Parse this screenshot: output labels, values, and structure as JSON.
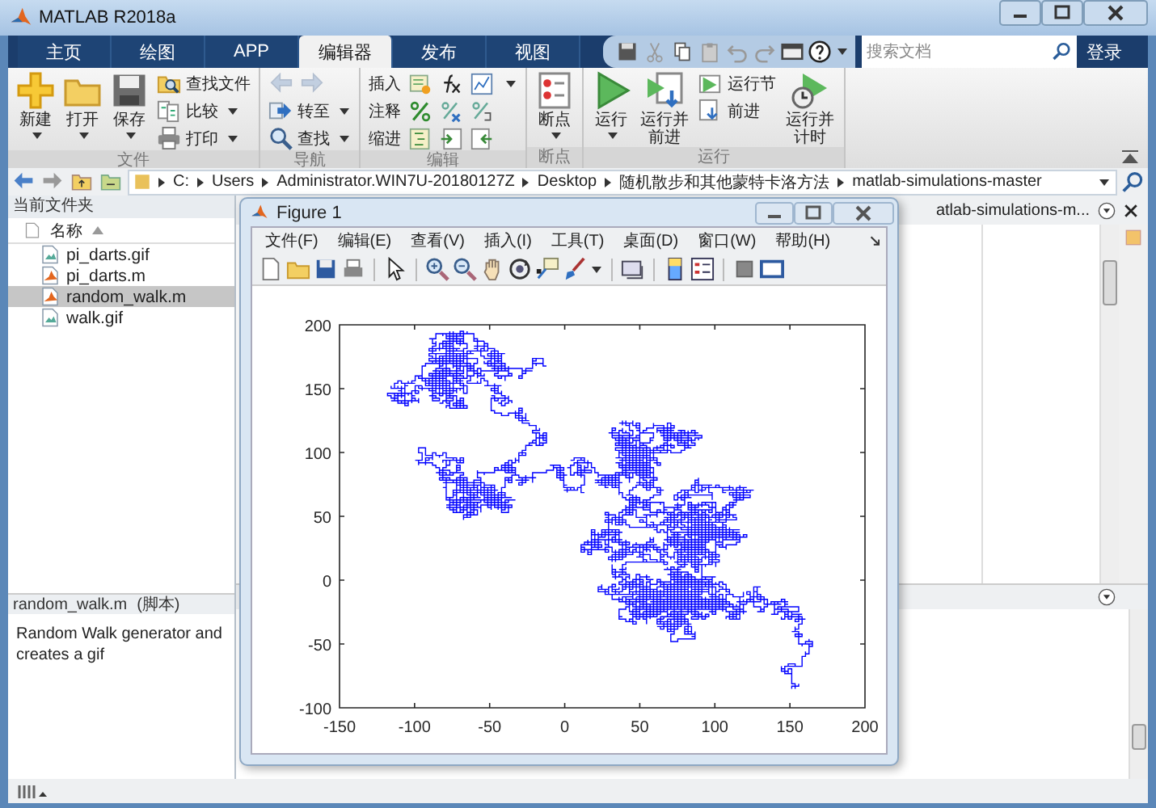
{
  "window": {
    "title": "MATLAB R2018a"
  },
  "tabs": [
    {
      "label": "主页",
      "selected": false
    },
    {
      "label": "绘图",
      "selected": false
    },
    {
      "label": "APP",
      "selected": false
    },
    {
      "label": "编辑器",
      "selected": true
    },
    {
      "label": "发布",
      "selected": false
    },
    {
      "label": "视图",
      "selected": false
    }
  ],
  "search": {
    "placeholder": "搜索文档"
  },
  "login": "登录",
  "ribbon": [
    {
      "label": "文件",
      "columns": [
        [
          {
            "kind": "large",
            "label": "新建",
            "menu": true
          }
        ],
        [
          {
            "kind": "large",
            "label": "打开",
            "menu": true
          }
        ],
        [
          {
            "kind": "large",
            "label": "保存",
            "menu": true
          }
        ],
        [
          {
            "kind": "small",
            "label": "查找文件",
            "menu": false
          },
          {
            "kind": "small",
            "label": "比较",
            "menu": true
          },
          {
            "kind": "small",
            "label": "打印",
            "menu": true
          }
        ]
      ]
    },
    {
      "label": "导航",
      "columns": [
        [
          {
            "kind": "arrows",
            "disabled": true
          },
          {
            "kind": "small",
            "label": "转至",
            "menu": true
          },
          {
            "kind": "small",
            "label": "查找",
            "menu": true
          }
        ]
      ]
    },
    {
      "label": "编辑",
      "columns": [
        [
          {
            "kind": "iconrow",
            "label": "插入",
            "menu": true
          },
          {
            "kind": "iconrow",
            "label": "注释",
            "menu": false
          },
          {
            "kind": "iconrow",
            "label": "缩进",
            "menu": false
          }
        ]
      ]
    },
    {
      "label": "断点",
      "columns": [
        [
          {
            "kind": "large",
            "label": "断点",
            "menu": true
          }
        ]
      ]
    },
    {
      "label": "运行",
      "columns": [
        [
          {
            "kind": "large",
            "label": "运行",
            "menu": true
          }
        ],
        [
          {
            "kind": "large",
            "label": "运行并前进",
            "menu": false
          }
        ],
        [
          {
            "kind": "small",
            "label": "运行节",
            "menu": false
          },
          {
            "kind": "small",
            "label": "前进",
            "menu": false
          }
        ],
        [
          {
            "kind": "large",
            "label": "运行并计时",
            "menu": false
          }
        ]
      ]
    }
  ],
  "address": {
    "segments": [
      "C:",
      "Users",
      "Administrator.WIN7U-20180127Z",
      "Desktop",
      "随机散步和其他蒙特卡洛方法",
      "matlab-simulations-master"
    ]
  },
  "file_browser": {
    "title": "当前文件夹",
    "column": "名称",
    "files": [
      {
        "name": "pi_darts.gif",
        "kind": "image",
        "selected": false
      },
      {
        "name": "pi_darts.m",
        "kind": "script",
        "selected": false
      },
      {
        "name": "random_walk.m",
        "kind": "script",
        "selected": true
      },
      {
        "name": "walk.gif",
        "kind": "image",
        "selected": false
      }
    ]
  },
  "details": {
    "file": "random_walk.m",
    "file_type": "(脚本)",
    "description": "Random Walk generator and creates a gif"
  },
  "editor_tab": {
    "label": "atlab-simulations-m..."
  },
  "figure": {
    "title": "Figure 1",
    "menus": [
      "文件(F)",
      "编辑(E)",
      "查看(V)",
      "插入(I)",
      "工具(T)",
      "桌面(D)",
      "窗口(W)",
      "帮助(H)"
    ],
    "yticks": [
      "200",
      "150",
      "100",
      "50",
      "0",
      "-50",
      "-100"
    ],
    "xticks": [
      "-150",
      "-100",
      "-50",
      "0",
      "50",
      "100",
      "150",
      "200"
    ]
  }
}
